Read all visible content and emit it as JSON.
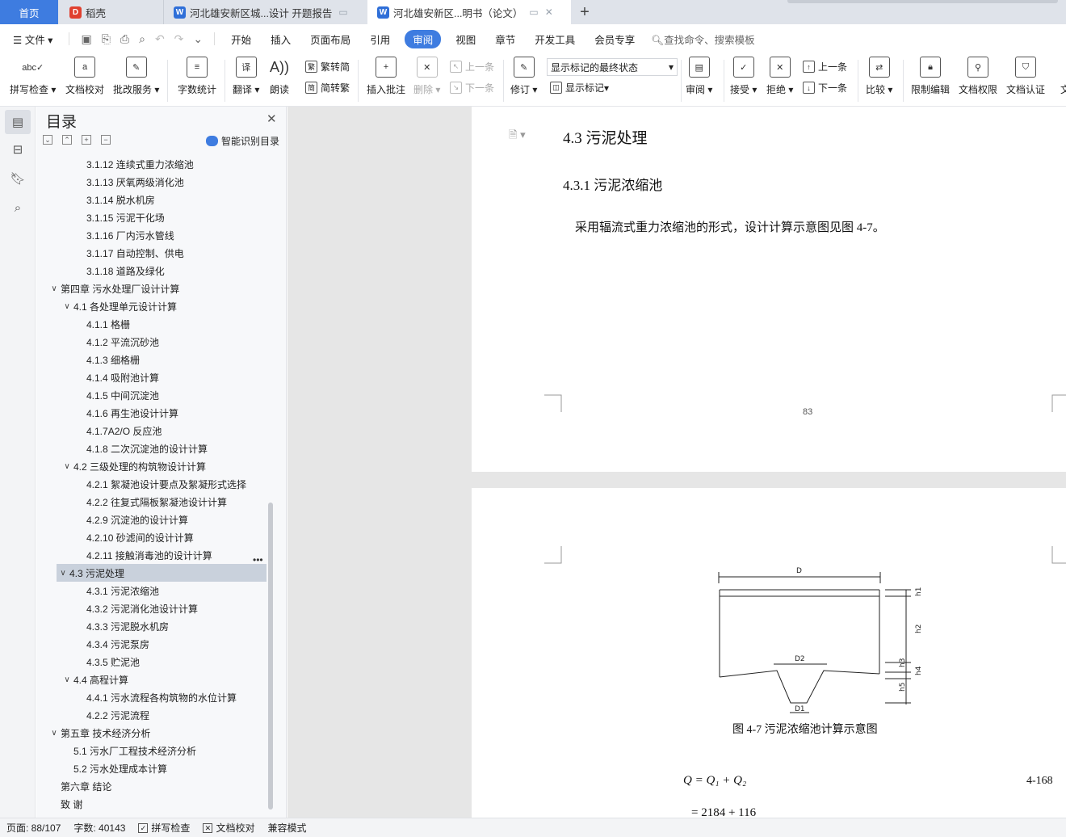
{
  "tabs": {
    "home": "首页",
    "daoke": "稻壳",
    "doc1": "河北雄安新区城...设计 开题报告",
    "doc2": "河北雄安新区...明书（论文）",
    "new_tab": "+"
  },
  "menu": {
    "file": "文件",
    "items": [
      "开始",
      "插入",
      "页面布局",
      "引用",
      "审阅",
      "视图",
      "章节",
      "开发工具",
      "会员专享"
    ],
    "active": "审阅",
    "search": "查找命令、搜索模板"
  },
  "ribbon": {
    "spell_check": "拼写检查",
    "doc_proof": "文档校对",
    "batch_service": "批改服务",
    "word_count": "字数统计",
    "translate": "翻译",
    "read_aloud": "朗读",
    "trad_to_simp": "繁转简",
    "simp_to_trad": "简转繁",
    "insert_comment": "插入批注",
    "delete": "删除",
    "prev": "上一条",
    "next": "下一条",
    "track_changes": "修订",
    "markup_state": "显示标记的最终状态",
    "show_markup": "显示标记",
    "review": "审阅",
    "accept": "接受",
    "reject": "拒绝",
    "prev2": "上一条",
    "next2": "下一条",
    "compare": "比较",
    "restrict_edit": "限制编辑",
    "doc_permission": "文档权限",
    "doc_cert": "文档认证",
    "cut_label": "文"
  },
  "toc": {
    "title": "目录",
    "smart": "智能识别目录",
    "items": [
      {
        "label": "3.1.12 连续式重力浓缩池",
        "level": 3
      },
      {
        "label": "3.1.13 厌氧两级消化池",
        "level": 3
      },
      {
        "label": "3.1.14 脱水机房",
        "level": 3
      },
      {
        "label": "3.1.15 污泥干化场",
        "level": 3
      },
      {
        "label": "3.1.16  厂内污水管线",
        "level": 3
      },
      {
        "label": "3.1.17  自动控制、供电",
        "level": 3
      },
      {
        "label": "3.1.18  道路及绿化",
        "level": 3
      },
      {
        "label": "第四章  污水处理厂设计计算",
        "level": 1
      },
      {
        "label": "4.1 各处理单元设计计算",
        "level": 2
      },
      {
        "label": "4.1.1 格栅",
        "level": 3
      },
      {
        "label": "4.1.2 平流沉砂池",
        "level": 3
      },
      {
        "label": "4.1.3 细格栅",
        "level": 3
      },
      {
        "label": "4.1.4 吸附池计算",
        "level": 3
      },
      {
        "label": "4.1.5 中间沉淀池",
        "level": 3
      },
      {
        "label": "4.1.6 再生池设计计算",
        "level": 3
      },
      {
        "label": "4.1.7A2/O 反应池",
        "level": 3
      },
      {
        "label": "4.1.8 二次沉淀池的设计计算",
        "level": 3
      },
      {
        "label": "4.2 三级处理的构筑物设计计算",
        "level": 2
      },
      {
        "label": "4.2.1 絮凝池设计要点及絮凝形式选择",
        "level": 3
      },
      {
        "label": "4.2.2 往复式隔板絮凝池设计计算",
        "level": 3
      },
      {
        "label": "4.2.9  沉淀池的设计计算",
        "level": 3
      },
      {
        "label": "4.2.10 砂滤间的设计计算",
        "level": 3
      },
      {
        "label": "4.2.11 接触消毒池的设计计算",
        "level": 3
      },
      {
        "label": "4.3 污泥处理",
        "level": 2,
        "selected": true
      },
      {
        "label": "4.3.1 污泥浓缩池",
        "level": 3
      },
      {
        "label": "4.3.2 污泥消化池设计计算",
        "level": 3
      },
      {
        "label": "4.3.3 污泥脱水机房",
        "level": 3
      },
      {
        "label": "4.3.4 污泥泵房",
        "level": 3
      },
      {
        "label": "4.3.5 贮泥池",
        "level": 3
      },
      {
        "label": "4.4 高程计算",
        "level": 2
      },
      {
        "label": "4.4.1 污水流程各构筑物的水位计算",
        "level": 3
      },
      {
        "label": "4.2.2 污泥流程",
        "level": 3
      },
      {
        "label": "第五章  技术经济分析",
        "level": 1
      },
      {
        "label": "5.1 污水厂工程技术经济分析",
        "level": 2
      },
      {
        "label": "5.2 污水处理成本计算",
        "level": 2
      },
      {
        "label": "第六章  结论",
        "level": 1
      },
      {
        "label": "致    谢",
        "level": 1
      }
    ]
  },
  "document": {
    "heading_43": "4.3 污泥处理",
    "heading_431": "4.3.1 污泥浓缩池",
    "paragraph": "采用辐流式重力浓缩池的形式，设计计算示意图见图 4-7。",
    "page_number": "83",
    "figure_caption": "图 4-7 污泥浓缩池计算示意图",
    "figure_labels": {
      "D": "D",
      "D2": "D2",
      "D1": "D1",
      "h1": "h1",
      "h2": "h2",
      "h3": "h3",
      "h4": "h4",
      "h5": "h5"
    },
    "equation1": "Q = Q₁ + Q₂",
    "equation1_number": "4-168",
    "equation2": "= 2184 + 116"
  },
  "status": {
    "page": "页面: 88/107",
    "words": "字数: 40143",
    "spell": "拼写检查",
    "proof": "文档校对",
    "compat": "兼容模式"
  }
}
